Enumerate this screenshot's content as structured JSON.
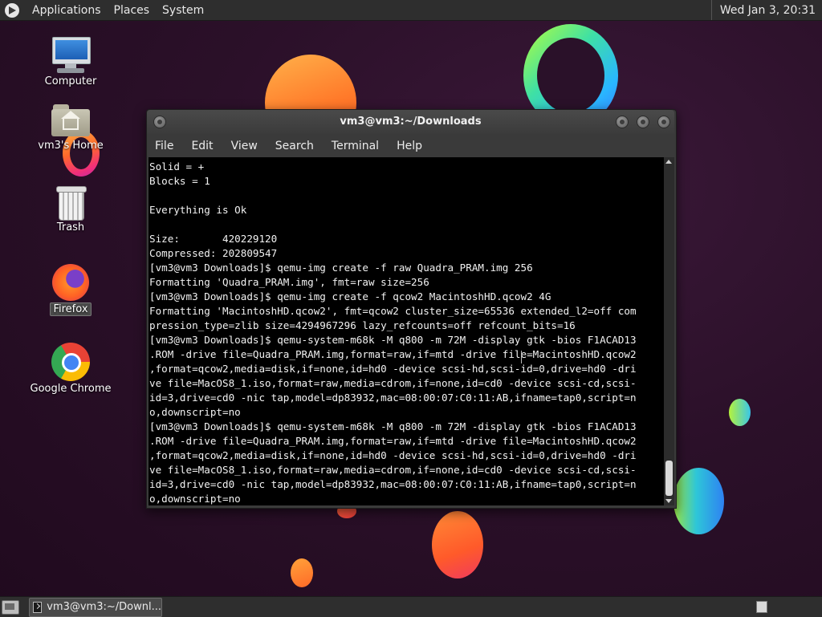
{
  "top_panel": {
    "menus": [
      "Applications",
      "Places",
      "System"
    ],
    "clock": "Wed Jan  3, 20:31"
  },
  "desktop_icons": [
    {
      "label": "Computer"
    },
    {
      "label": "vm3's Home"
    },
    {
      "label": "Trash"
    },
    {
      "label": "Firefox"
    },
    {
      "label": "Google Chrome"
    }
  ],
  "terminal": {
    "title": "vm3@vm3:~/Downloads",
    "menu": [
      "File",
      "Edit",
      "View",
      "Search",
      "Terminal",
      "Help"
    ],
    "lines": [
      "Solid = +",
      "Blocks = 1",
      "",
      "Everything is Ok",
      "",
      "Size:       420229120",
      "Compressed: 202809547",
      "[vm3@vm3 Downloads]$ qemu-img create -f raw Quadra_PRAM.img 256",
      "Formatting 'Quadra_PRAM.img', fmt=raw size=256",
      "[vm3@vm3 Downloads]$ qemu-img create -f qcow2 MacintoshHD.qcow2 4G",
      "Formatting 'MacintoshHD.qcow2', fmt=qcow2 cluster_size=65536 extended_l2=off com",
      "pression_type=zlib size=4294967296 lazy_refcounts=off refcount_bits=16",
      "[vm3@vm3 Downloads]$ qemu-system-m68k -M q800 -m 72M -display gtk -bios F1ACAD13",
      ".ROM -drive file=Quadra_PRAM.img,format=raw,if=mtd -drive file=MacintoshHD.qcow2",
      ",format=qcow2,media=disk,if=none,id=hd0 -device scsi-hd,scsi-id=0,drive=hd0 -dri",
      "ve file=MacOS8_1.iso,format=raw,media=cdrom,if=none,id=cd0 -device scsi-cd,scsi-",
      "id=3,drive=cd0 -nic tap,model=dp83932,mac=08:00:07:C0:11:AB,ifname=tap0,script=n",
      "o,downscript=no",
      "[vm3@vm3 Downloads]$ qemu-system-m68k -M q800 -m 72M -display gtk -bios F1ACAD13",
      ".ROM -drive file=Quadra_PRAM.img,format=raw,if=mtd -drive file=MacintoshHD.qcow2",
      ",format=qcow2,media=disk,if=none,id=hd0 -device scsi-hd,scsi-id=0,drive=hd0 -dri",
      "ve file=MacOS8_1.iso,format=raw,media=cdrom,if=none,id=cd0 -device scsi-cd,scsi-",
      "id=3,drive=cd0 -nic tap,model=dp83932,mac=08:00:07:C0:11:AB,ifname=tap0,script=n",
      "o,downscript=no"
    ]
  },
  "taskbar": {
    "task_label": "vm3@vm3:~/Downl..."
  }
}
